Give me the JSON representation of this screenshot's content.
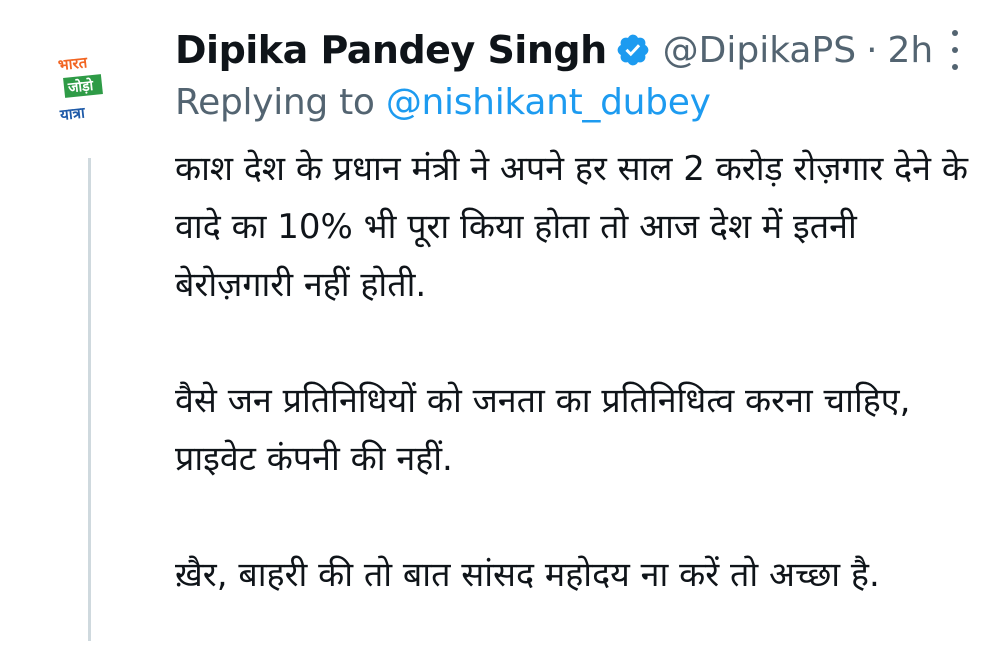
{
  "author": {
    "name": "Dipika Pandey Singh",
    "handle": "@DipikaPS",
    "separator": "·",
    "time": "2h",
    "verified_icon": "verified-badge-icon",
    "avatar_logo": {
      "line1": "भारत",
      "line2": "जोड़ो",
      "line3": "यात्रा"
    }
  },
  "reply": {
    "prefix": "Replying to ",
    "mention": "@nishikant_dubey"
  },
  "paragraphs": [
    "काश देश के प्रधान मंत्री ने अपने हर साल 2 करोड़ रोज़गार देने के वादे का 10% भी पूरा किया होता तो आज देश में इतनी बेरोज़गारी नहीं होती.",
    "वैसे जन प्रतिनिधियों को जनता का प्रतिनिधित्व करना चाहिए, प्राइवेट कंपनी की नहीं.",
    "ख़ैर, बाहरी की तो बात सांसद महोदय ना करें तो अच्छा है."
  ],
  "colors": {
    "text": "#0f1419",
    "muted": "#536471",
    "link": "#1d9bf0",
    "thread_line": "#cfd9de",
    "logo_orange": "#f26522",
    "logo_green": "#2e9b46",
    "logo_blue": "#1e5aa8"
  }
}
